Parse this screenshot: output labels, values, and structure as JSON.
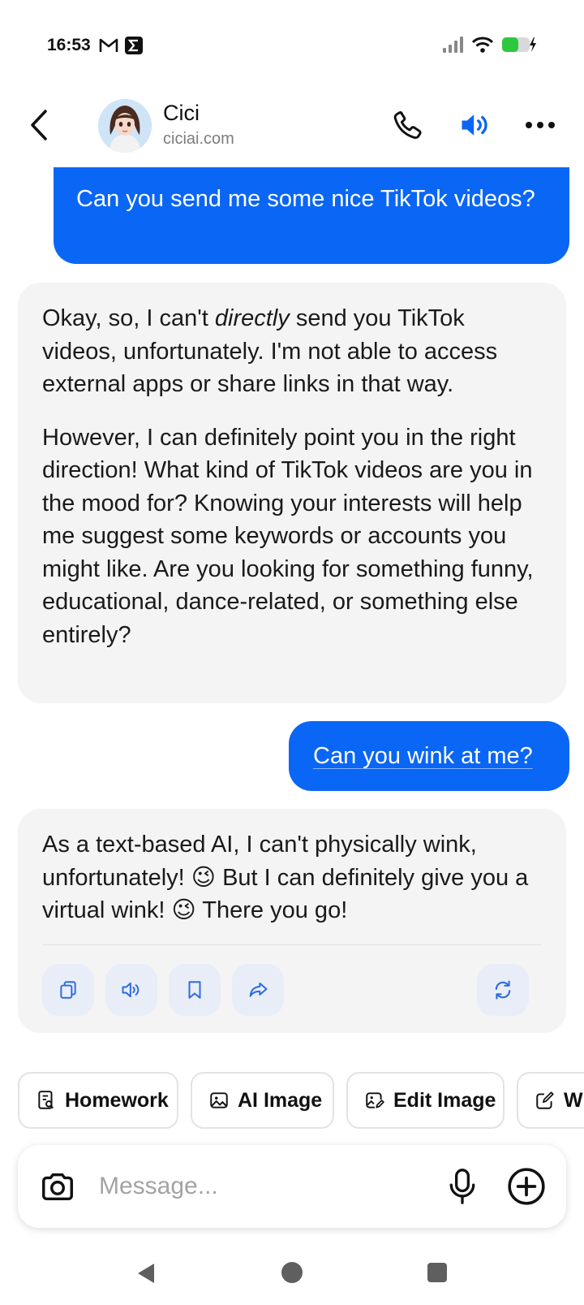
{
  "status_bar": {
    "time": "16:53",
    "left_icons": [
      "gmail-icon",
      "sigma-app-icon"
    ],
    "right_icons": [
      "signal-icon",
      "wifi-icon",
      "battery-charging-icon"
    ]
  },
  "header": {
    "name": "Cici",
    "domain": "ciciai.com",
    "icons": [
      "back-arrow-icon",
      "phone-icon",
      "speaker-icon",
      "more-dots-icon"
    ]
  },
  "messages": [
    {
      "role": "user",
      "text": "Can you send me some nice TikTok videos?"
    },
    {
      "role": "bot",
      "para1_a": "Okay, so, I can't ",
      "para1_em": "directly",
      "para1_b": " send you TikTok videos, unfortunately. I'm not able to access external apps or share links in that way.",
      "para2": "However, I can definitely point you in the right direction! What kind of TikTok videos are you in the mood for? Knowing your interests will help me suggest some keywords or accounts you might like. Are you looking for something funny, educational, dance-related, or something else entirely?"
    },
    {
      "role": "user",
      "text": "Can you wink at me?"
    },
    {
      "role": "bot",
      "text": "As a text-based AI, I can't physically wink, unfortunately! 😉 But I can definitely give you a virtual wink! 😉 There you go!",
      "actions": [
        "copy-icon",
        "read-aloud-icon",
        "bookmark-icon",
        "share-icon",
        "regenerate-icon"
      ]
    }
  ],
  "chips": [
    {
      "label": "Homework",
      "icon": "homework-icon"
    },
    {
      "label": "AI Image",
      "icon": "image-icon"
    },
    {
      "label": "Edit Image",
      "icon": "edit-image-icon"
    },
    {
      "label": "W",
      "icon": "write-icon"
    }
  ],
  "input": {
    "placeholder": "Message...",
    "icons": [
      "camera-icon",
      "microphone-icon",
      "plus-circle-icon"
    ]
  },
  "colors": {
    "accent": "#0a66f5",
    "bot_bubble": "#f4f4f5",
    "action_button_bg": "#e8edf8"
  }
}
